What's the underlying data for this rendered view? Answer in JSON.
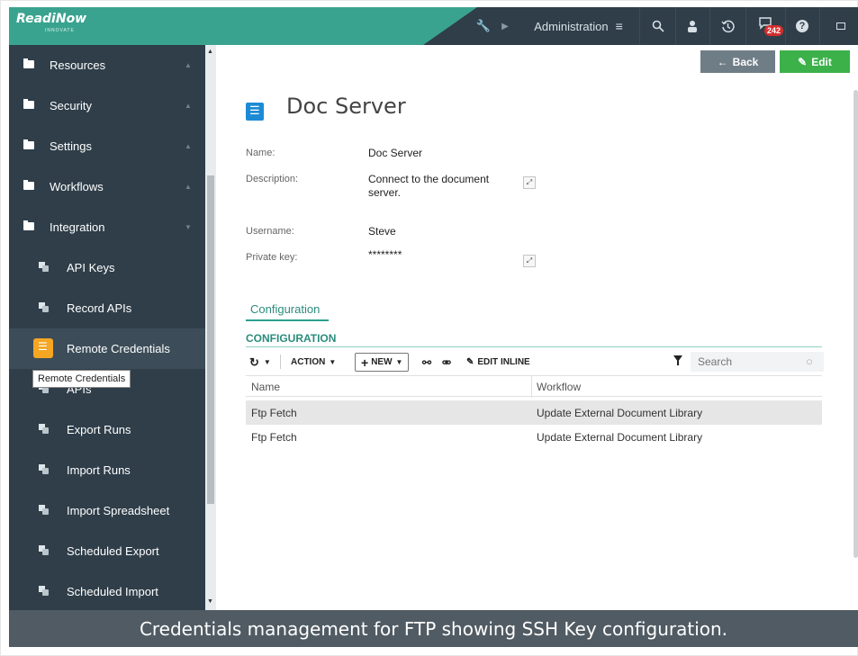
{
  "app": {
    "logo": "ReadiNow",
    "logo_sub": "INNOVATE"
  },
  "topbar": {
    "admin_label": "Administration",
    "notification_count": "242",
    "icons": [
      "wrench-icon",
      "play-icon",
      "menu-icon",
      "search-icon",
      "user-icon",
      "history-icon",
      "chat-icon",
      "help-icon",
      "window-icon"
    ]
  },
  "sidebar": {
    "sections": [
      {
        "label": "Resources"
      },
      {
        "label": "Security"
      },
      {
        "label": "Settings"
      },
      {
        "label": "Workflows"
      },
      {
        "label": "Integration"
      }
    ],
    "items": [
      {
        "label": "API Keys"
      },
      {
        "label": "Record APIs"
      },
      {
        "label": "Remote Credentials"
      },
      {
        "label": "APIs"
      },
      {
        "label": "Export Runs"
      },
      {
        "label": "Import Runs"
      },
      {
        "label": "Import Spreadsheet"
      },
      {
        "label": "Scheduled Export"
      },
      {
        "label": "Scheduled Import"
      }
    ],
    "tooltip": "Remote Credentials"
  },
  "actions": {
    "back": "Back",
    "edit": "Edit"
  },
  "record": {
    "title": "Doc Server",
    "fields": {
      "name_label": "Name:",
      "name_value": "Doc Server",
      "description_label": "Description:",
      "description_value": "Connect to the document server.",
      "username_label": "Username:",
      "username_value": "Steve",
      "private_key_label": "Private key:",
      "private_key_value": "********"
    }
  },
  "tabs": {
    "configuration": "Configuration"
  },
  "section": {
    "title": "CONFIGURATION"
  },
  "toolbar": {
    "action": "ACTION",
    "new": "NEW",
    "edit_inline": "EDIT INLINE",
    "search_placeholder": "Search"
  },
  "table": {
    "columns": [
      "Name",
      "Workflow"
    ],
    "rows": [
      {
        "name": "Ftp Fetch",
        "workflow": "Update External Document Library"
      },
      {
        "name": "Ftp Fetch",
        "workflow": "Update External Document Library"
      }
    ]
  },
  "caption": "Credentials management for FTP showing SSH Key configuration.",
  "colors": {
    "brand": "#3aa38f",
    "sidebar": "#2f3e49",
    "accent": "#2b8c7c",
    "edit_button": "#3cb14a",
    "active_icon": "#f5a623"
  }
}
